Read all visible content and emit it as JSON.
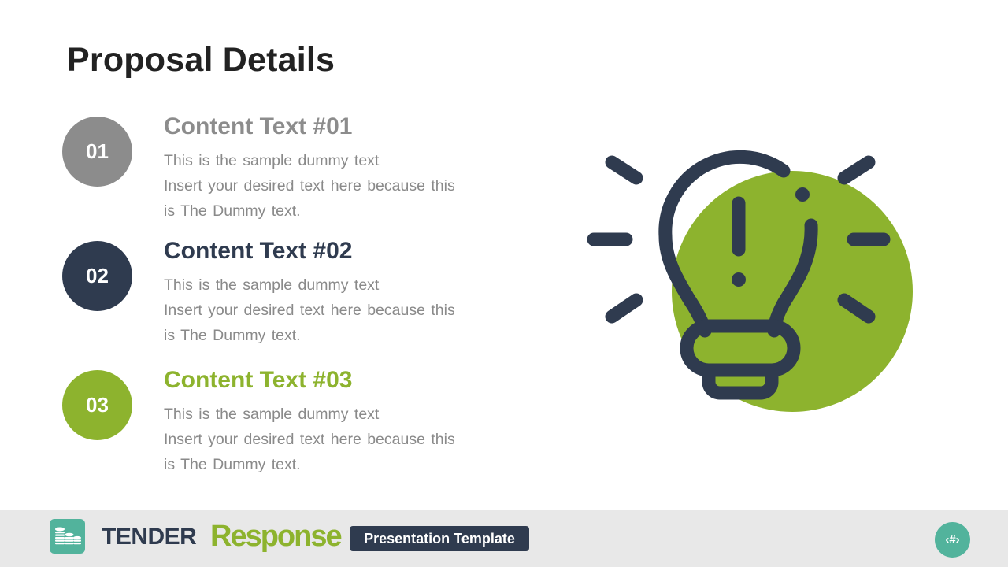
{
  "slide": {
    "title": "Proposal Details"
  },
  "items": [
    {
      "number": "01",
      "title": "Content Text #01",
      "color": "#8c8c8c",
      "lines": [
        "This is the sample dummy text",
        "Insert your desired text here because this",
        "is The Dummy text."
      ]
    },
    {
      "number": "02",
      "title": "Content Text #02",
      "color": "#2f3b4f",
      "lines": [
        "This is the sample dummy text",
        "Insert your desired text here because this",
        "is The Dummy text."
      ]
    },
    {
      "number": "03",
      "title": "Content Text #03",
      "color": "#8db32e",
      "lines": [
        "This is the sample dummy text",
        "Insert your desired text here because this",
        "is The Dummy text."
      ]
    }
  ],
  "illustration": {
    "icon": "lightbulb-idea-icon",
    "bulb_color": "#2f3b4f",
    "circle_color": "#8db32e"
  },
  "footer": {
    "logo_icon": "coin-stacks-icon",
    "brand_primary": "TENDER",
    "brand_secondary": "Response",
    "tag_label": "Presentation Template",
    "page_number": "‹#›",
    "accent": "#52b39c"
  }
}
